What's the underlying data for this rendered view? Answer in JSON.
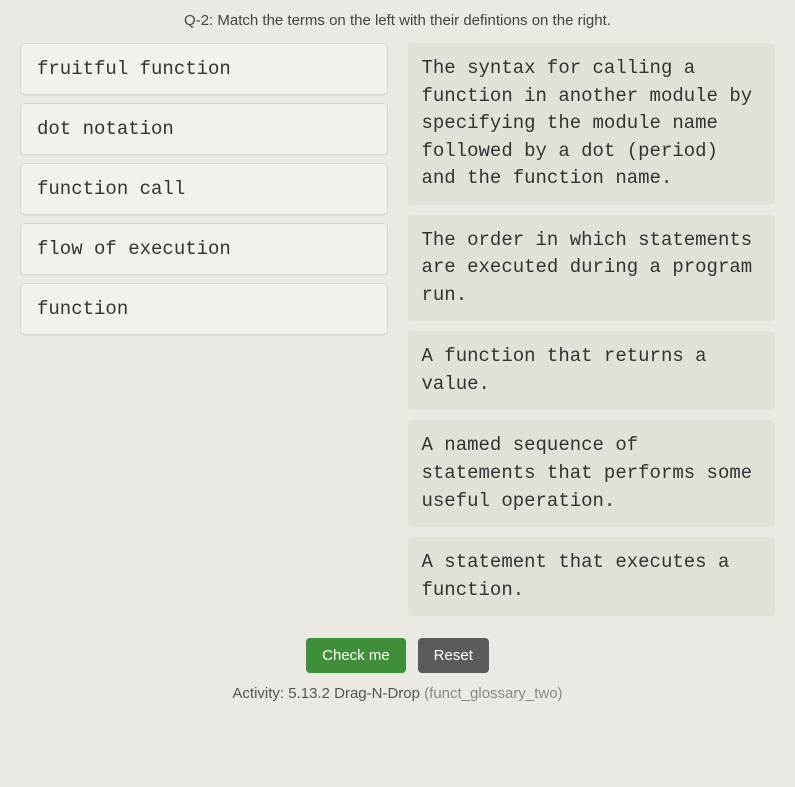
{
  "question": "Q-2: Match the terms on the left with their defintions on the right.",
  "terms": [
    "fruitful function",
    "dot notation",
    "function call",
    "flow of execution",
    "function"
  ],
  "definitions": [
    "The syntax for calling a function in another module by specifying the module name followed by a dot (period) and the function name.",
    "The order in which statements are executed during a program run.",
    "A function that returns a value.",
    "A named sequence of statements that performs some useful operation.",
    "A statement that executes a function."
  ],
  "buttons": {
    "check": "Check me",
    "reset": "Reset"
  },
  "activity": {
    "prefix": "Activity: 5.13.2 Drag-N-Drop ",
    "slug": "(funct_glossary_two)"
  }
}
